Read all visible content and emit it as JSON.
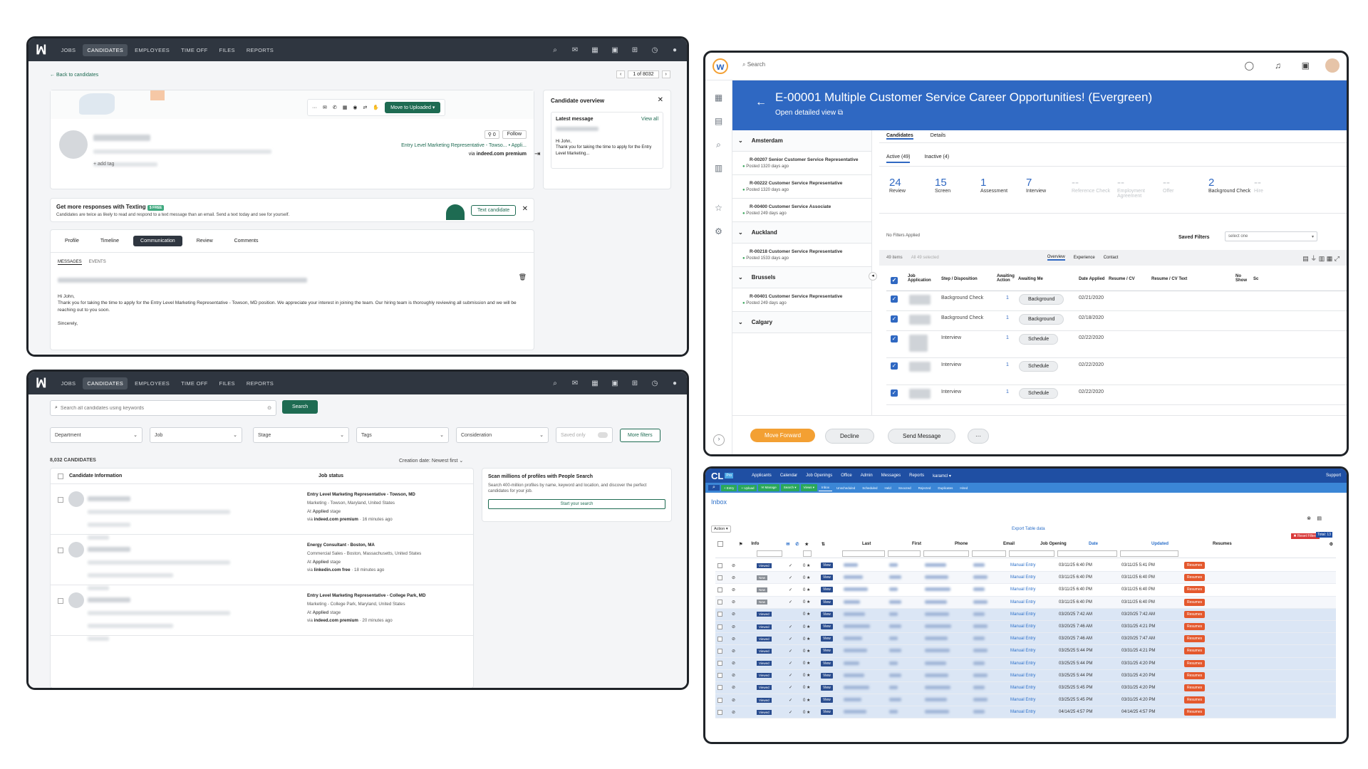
{
  "p1": {
    "nav": [
      "JOBS",
      "CANDIDATES",
      "EMPLOYEES",
      "TIME OFF",
      "FILES",
      "REPORTS"
    ],
    "back": "← Back to candidates",
    "pager": "1 of 8032",
    "move_btn": "Move to Uploaded",
    "follow": "Follow",
    "follow_count": "0",
    "job_link": "Entry Level Marketing Representative - Towso... • Appli...",
    "via_prefix": "via ",
    "via": "indeed.com premium",
    "add_tag": "+ add tag",
    "overview_title": "Candidate overview",
    "latest": "Latest message",
    "view_all": "View all",
    "latest_msg": "Hi John,\nThank you for taking the time to apply for the Entry Level Marketing...",
    "promo_title": "Get more responses with Texting",
    "promo_badge": "$ FREE",
    "promo_body": "Candidates are twice as likely to read and respond to a text message than an email. Send a text today and see for yourself.",
    "text_btn": "Text candidate",
    "tabs": [
      "Profile",
      "Timeline",
      "Communication",
      "Review",
      "Comments"
    ],
    "subtabs": [
      "MESSAGES",
      "EVENTS"
    ],
    "msg_greeting": "Hi John,",
    "msg_body": "Thank you for taking the time to apply for the Entry Level Marketing Representative - Towson, MD position. We appreciate your interest in joining the team. Our hiring team is thoroughly reviewing all submission and we will be reaching out to you soon.",
    "msg_sign": "Sincerely,"
  },
  "p2": {
    "nav": [
      "JOBS",
      "CANDIDATES",
      "EMPLOYEES",
      "TIME OFF",
      "FILES",
      "REPORTS"
    ],
    "search_placeholder": "Search all candidates using keywords",
    "search_btn": "Search",
    "filters": [
      "Department",
      "Job",
      "Stage",
      "Tags",
      "Consideration"
    ],
    "saved_only": "Saved only",
    "more_filters": "More filters",
    "count": "8,032 CANDIDATES",
    "sort": "Creation date: Newest first",
    "col_info": "Candidate Information",
    "col_status": "Job status",
    "rows": [
      {
        "job": "Entry Level Marketing Representative - Towson, MD",
        "dept": "Marketing - Towson, Maryland, United States",
        "stage_pre": "At ",
        "stage": "Applied",
        "stage_post": " stage",
        "via": "indeed.com premium",
        "time": " · 16 minutes ago"
      },
      {
        "job": "Energy Consultant - Boston, MA",
        "dept": "Commercial Sales - Boston, Massachusetts, United States",
        "stage_pre": "At ",
        "stage": "Applied",
        "stage_post": " stage",
        "via": "linkedin.com free",
        "time": " · 18 minutes ago"
      },
      {
        "job": "Entry Level Marketing Representative - College Park, MD",
        "dept": "Marketing - College Park, Maryland, United States",
        "stage_pre": "At ",
        "stage": "Applied",
        "stage_post": " stage",
        "via": "indeed.com premium",
        "time": " · 20 minutes ago"
      }
    ],
    "via_prefix": "via ",
    "side_title": "Scan millions of profiles with People Search",
    "side_body": "Search 400-million profiles by name, keyword and location, and discover the perfect candidates for your job.",
    "side_btn": "Start your search"
  },
  "p3": {
    "search": "Search",
    "title": "E-00001 Multiple Customer Service Career Opportunities! (Evergreen)",
    "subtitle": "Open detailed view",
    "groups": [
      {
        "city": "Amsterdam",
        "reqs": [
          {
            "name": "R-00207 Senior Customer Service Representative",
            "posted": "Posted 1320 days ago"
          },
          {
            "name": "R-00222 Customer Service Representative",
            "posted": "Posted 1320 days ago"
          },
          {
            "name": "R-00400 Customer Service Associate",
            "posted": "Posted 249 days ago"
          }
        ]
      },
      {
        "city": "Auckland",
        "reqs": [
          {
            "name": "R-00218 Customer Service Representative",
            "posted": "Posted 1533 days ago"
          }
        ]
      },
      {
        "city": "Brussels",
        "reqs": [
          {
            "name": "R-00401 Customer Service Representative",
            "posted": "Posted 249 days ago"
          }
        ]
      },
      {
        "city": "Calgary",
        "reqs": []
      }
    ],
    "tabs": [
      "Candidates",
      "Details"
    ],
    "subtabs": [
      "Active (49)",
      "Inactive (4)"
    ],
    "stages": [
      {
        "n": "24",
        "l": "Review"
      },
      {
        "n": "15",
        "l": "Screen"
      },
      {
        "n": "1",
        "l": "Assessment"
      },
      {
        "n": "7",
        "l": "Interview"
      },
      {
        "n": "--",
        "l": "Reference Check"
      },
      {
        "n": "--",
        "l": "Employment Agreement"
      },
      {
        "n": "--",
        "l": "Offer"
      },
      {
        "n": "2",
        "l": "Background Check"
      },
      {
        "n": "--",
        "l": "Hire"
      }
    ],
    "no_filters": "No Filters Applied",
    "saved_filters": "Saved Filters",
    "select_one": "select one",
    "items": "49 items",
    "selected": "All 49 selected",
    "view_tabs": [
      "Overview",
      "Experience",
      "Contact"
    ],
    "cols": [
      "Job Application",
      "Step / Disposition",
      "Awaiting Action",
      "Awaiting Me",
      "Date Applied",
      "Resume / CV",
      "Resume / CV Text",
      "No Show",
      "Sc"
    ],
    "rows": [
      {
        "step": "Background Check",
        "aw": "1",
        "btn": "Background",
        "date": "02/21/2020"
      },
      {
        "step": "Background Check",
        "aw": "1",
        "btn": "Background",
        "date": "02/18/2020"
      },
      {
        "step": "Interview",
        "aw": "1",
        "btn": "Schedule",
        "date": "02/22/2020"
      },
      {
        "step": "Interview",
        "aw": "1",
        "btn": "Schedule",
        "date": "02/22/2020"
      },
      {
        "step": "Interview",
        "aw": "1",
        "btn": "Schedule",
        "date": "02/22/2020"
      }
    ],
    "actions": [
      "Move Forward",
      "Decline",
      "Send Message",
      "···"
    ]
  },
  "p4": {
    "logo": "CL",
    "logo_badge": "Pro",
    "menu": [
      "Applicants",
      "Calendar",
      "Job Openings",
      "Office",
      "Admin",
      "Messages",
      "Reports",
      "karamcl ▾"
    ],
    "support": "Support",
    "tabs": [
      "+ Entry",
      "+ Upload",
      "✉ Manage",
      "Search ▾",
      "Views ▾",
      "Inbox",
      "Unscheduled",
      "Scheduled",
      "Held",
      "Snoozed",
      "Rejected",
      "Duplicates",
      "Hired"
    ],
    "page_title": "Inbox",
    "action": "Action ▾",
    "export": "Export Table data",
    "reset": "✖ Reset Filters",
    "total": "Total: 13",
    "cols": [
      "Info",
      "Last",
      "First",
      "Phone",
      "Email",
      "Job Opening",
      "Date",
      "Updated",
      "Resumes"
    ],
    "rows": [
      {
        "info": "Viewed",
        "chk": "✓",
        "score": "0 ★",
        "opening": "Manual Entry",
        "date": "03/11/25 6:40 PM",
        "updated": "03/11/25 5:41 PM"
      },
      {
        "info": "New",
        "chk": "✓",
        "score": "0 ★",
        "opening": "Manual Entry",
        "date": "03/11/25 6:40 PM",
        "updated": "03/11/25 6:40 PM"
      },
      {
        "info": "New",
        "chk": "✓",
        "score": "0 ★",
        "opening": "Manual Entry",
        "date": "03/11/25 6:40 PM",
        "updated": "03/11/25 6:40 PM"
      },
      {
        "info": "New",
        "chk": "✓",
        "score": "0 ★",
        "opening": "Manual Entry",
        "date": "03/11/25 6:40 PM",
        "updated": "03/11/25 6:40 PM"
      },
      {
        "info": "Viewed",
        "chk": "",
        "score": "0 ★",
        "opening": "Manual Entry",
        "date": "03/20/25 7:42 AM",
        "updated": "03/20/25 7:42 AM"
      },
      {
        "info": "Viewed",
        "chk": "✓",
        "score": "0 ★",
        "opening": "Manual Entry",
        "date": "03/20/25 7:46 AM",
        "updated": "03/31/25 4:21 PM"
      },
      {
        "info": "Viewed",
        "chk": "✓",
        "score": "0 ★",
        "opening": "Manual Entry",
        "date": "03/20/25 7:46 AM",
        "updated": "03/20/25 7:47 AM"
      },
      {
        "info": "Viewed",
        "chk": "✓",
        "score": "0 ★",
        "opening": "Manual Entry",
        "date": "03/25/25 5:44 PM",
        "updated": "03/31/25 4:21 PM"
      },
      {
        "info": "Viewed",
        "chk": "✓",
        "score": "0 ★",
        "opening": "Manual Entry",
        "date": "03/25/25 5:44 PM",
        "updated": "03/31/25 4:20 PM"
      },
      {
        "info": "Viewed",
        "chk": "✓",
        "score": "0 ★",
        "opening": "Manual Entry",
        "date": "03/25/25 5:44 PM",
        "updated": "03/31/25 4:20 PM"
      },
      {
        "info": "Viewed",
        "chk": "✓",
        "score": "0 ★",
        "opening": "Manual Entry",
        "date": "03/25/25 5:45 PM",
        "updated": "03/31/25 4:20 PM"
      },
      {
        "info": "Viewed",
        "chk": "✓",
        "score": "0 ★",
        "opening": "Manual Entry",
        "date": "03/25/25 5:45 PM",
        "updated": "03/31/25 4:20 PM"
      },
      {
        "info": "Viewed",
        "chk": "✓",
        "score": "0 ★",
        "opening": "Manual Entry",
        "date": "04/14/25 4:57 PM",
        "updated": "04/14/25 4:57 PM"
      }
    ],
    "view": "View",
    "resumes": "Resumes"
  },
  "colors": {
    "workable_green": "#1e6b52",
    "workday_blue": "#2f68c2",
    "workday_orange": "#f3a033",
    "cl_blue": "#1f4fa3",
    "cl_orange": "#e4582d"
  }
}
